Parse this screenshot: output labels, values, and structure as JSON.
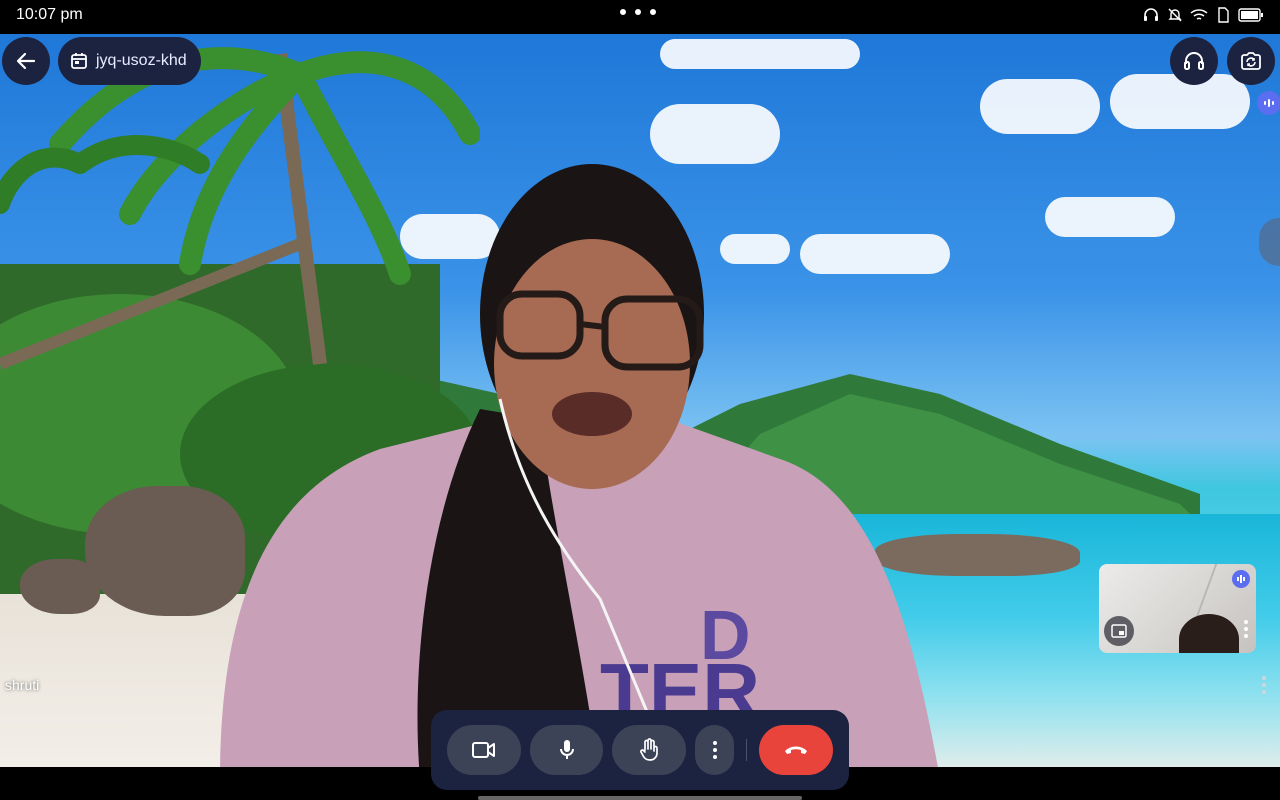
{
  "status_bar": {
    "time": "10:07 pm",
    "icons": [
      "headset-icon",
      "notifications-off-icon",
      "wifi-icon",
      "sim-icon",
      "battery-icon"
    ]
  },
  "meeting": {
    "code": "jyq-usoz-khd",
    "participant_name": "shruti"
  },
  "top_right": {
    "audio_output_icon": "headset-icon",
    "switch_camera_icon": "switch-camera-icon"
  },
  "controls": {
    "camera_icon": "videocam-icon",
    "mic_icon": "mic-icon",
    "raise_hand_icon": "hand-icon",
    "more_icon": "more-vert-icon",
    "end_call_icon": "call-end-icon"
  },
  "colors": {
    "chip_bg": "#1c2340",
    "control_bg": "#3d4357",
    "end_call": "#e9443b",
    "speaking": "#5b6df0"
  }
}
